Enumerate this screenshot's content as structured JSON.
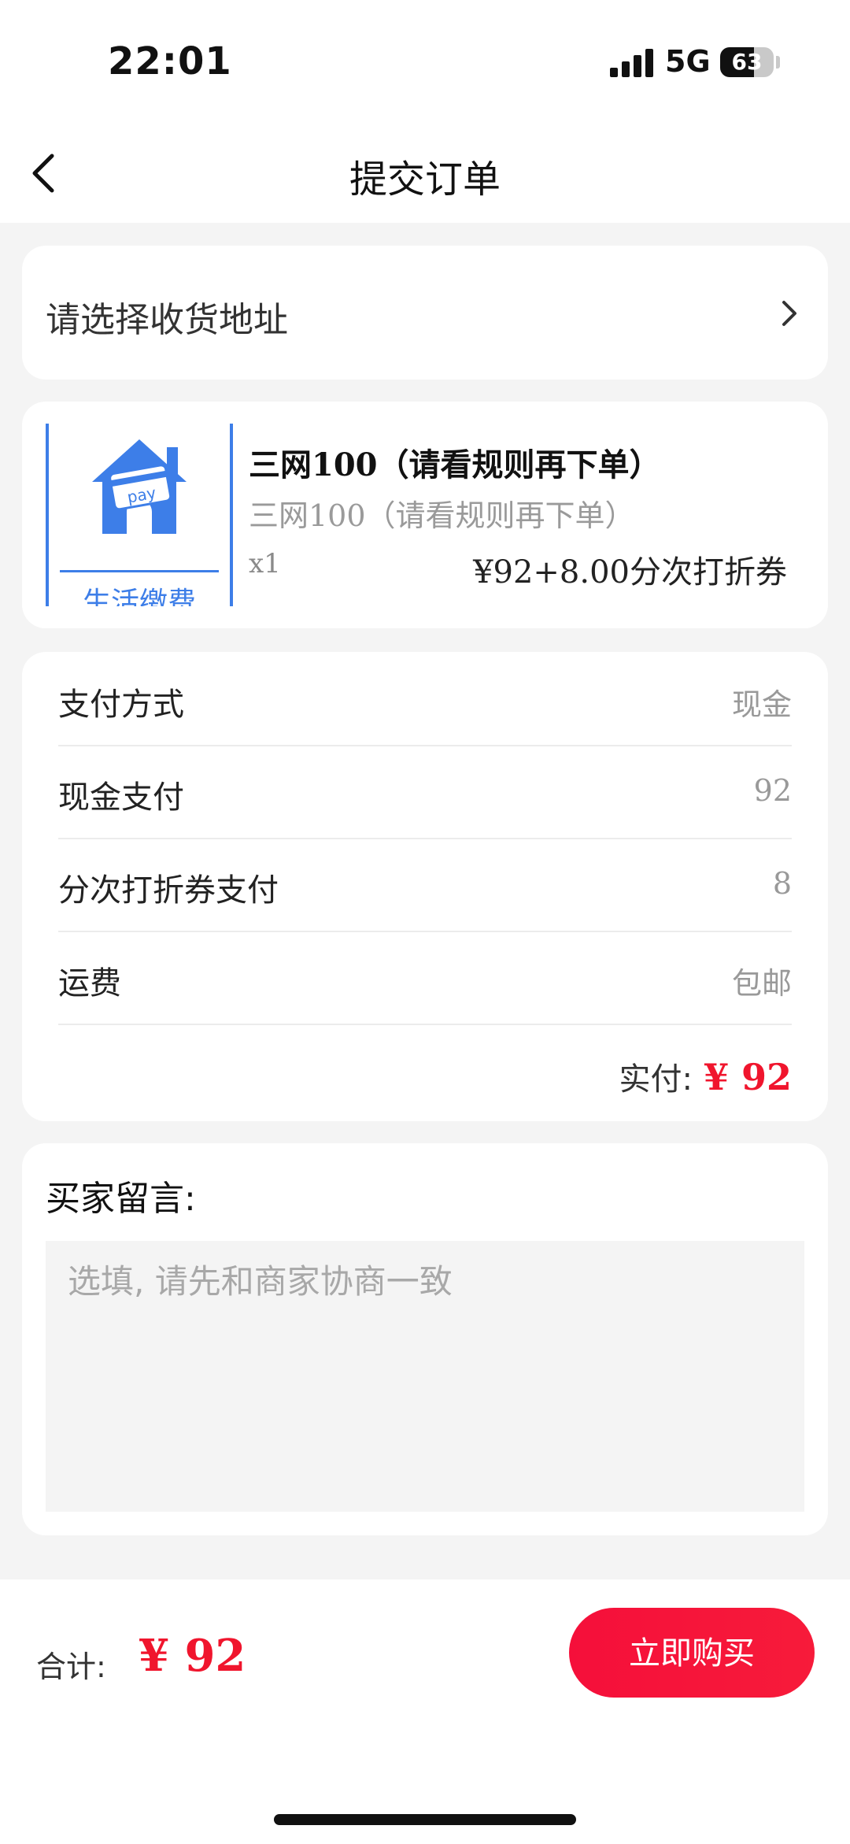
{
  "status_bar": {
    "time": "22:01",
    "network": "5G",
    "battery": "63",
    "battery_level": 0.63
  },
  "header": {
    "title": "提交订单"
  },
  "address": {
    "label": "请选择收货地址"
  },
  "product": {
    "image_caption": "生活缴费",
    "image_badge": "pay",
    "title": "三网100（请看规则再下单）",
    "subtitle": "三网100（请看规则再下单）",
    "quantity": "x1",
    "price": "¥92+8.00分次打折券"
  },
  "payment": {
    "rows": [
      {
        "key": "支付方式",
        "value": "现金"
      },
      {
        "key": "现金支付",
        "value": "92"
      },
      {
        "key": "分次打折券支付",
        "value": "8"
      },
      {
        "key": "运费",
        "value": "包邮"
      }
    ],
    "total_label": "实付:",
    "total_amount": "¥ 92"
  },
  "message": {
    "label": "买家留言:",
    "placeholder": "选填, 请先和商家协商一致"
  },
  "footer": {
    "sum_label": "合计:",
    "sum_amount": "¥ 92",
    "buy_label": "立即购买"
  },
  "colors": {
    "accent": "#f0152d",
    "icon_blue": "#3d7ee8"
  }
}
